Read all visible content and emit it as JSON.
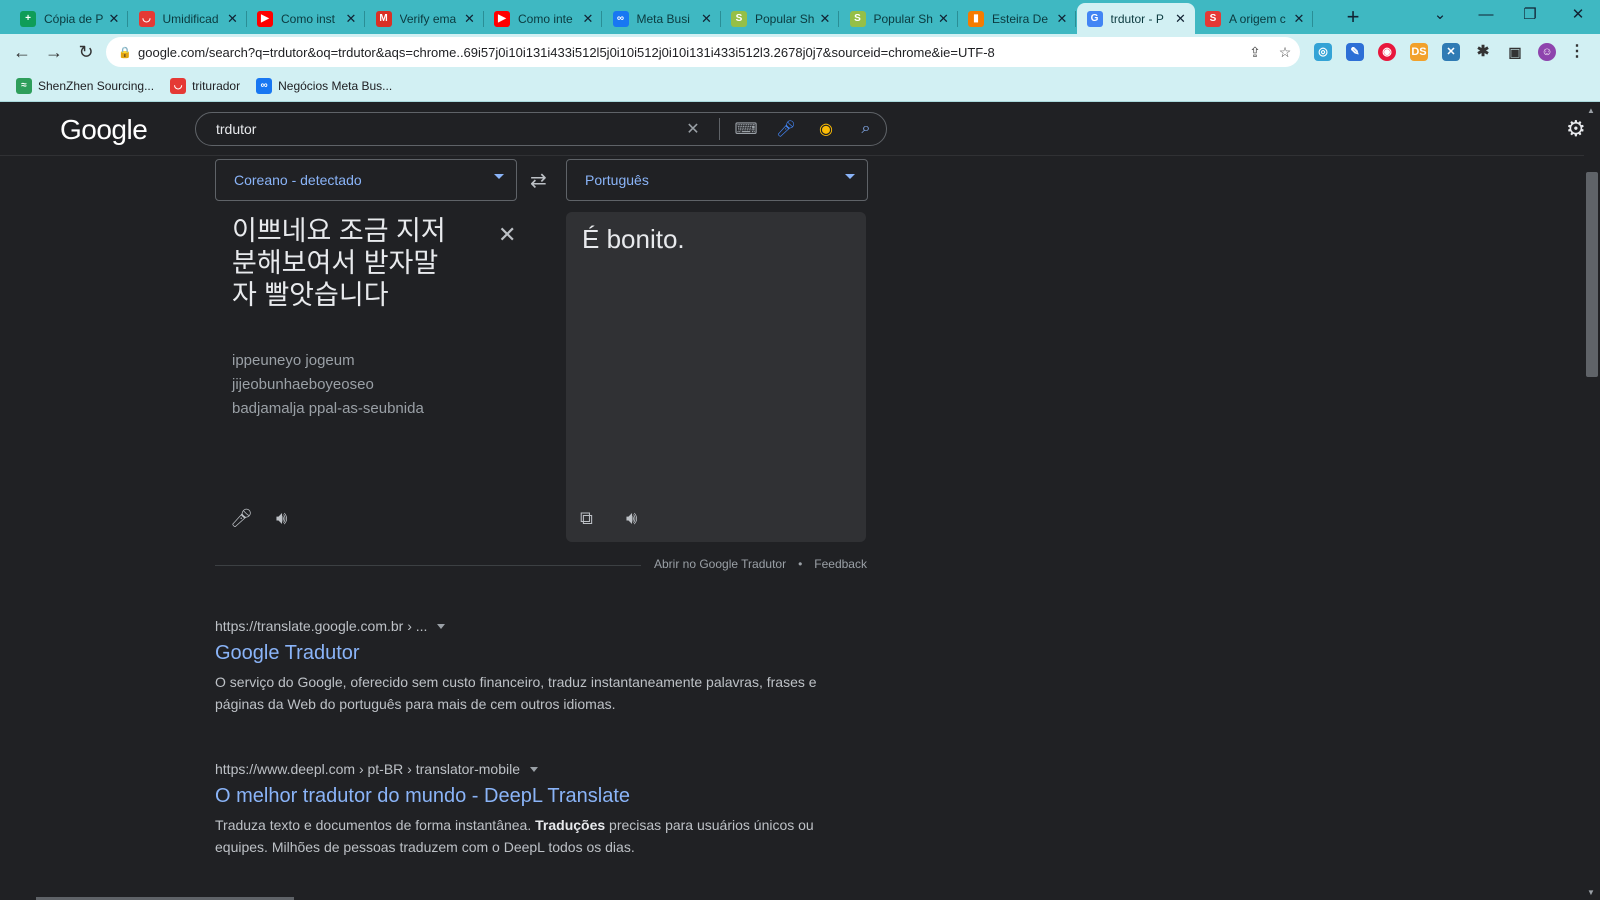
{
  "browser": {
    "tabs": [
      {
        "title": "Cópia de P",
        "icon": "sheets-icon",
        "color": "#0f9d58",
        "glyph": "+"
      },
      {
        "title": "Umidificad",
        "icon": "shopping-bag-icon",
        "color": "#e53935",
        "glyph": "◡"
      },
      {
        "title": "Como inst",
        "icon": "youtube-icon",
        "color": "#ff0000",
        "glyph": "▶"
      },
      {
        "title": "Verify ema",
        "icon": "gmail-icon",
        "color": "#d93025",
        "glyph": "M"
      },
      {
        "title": "Como inte",
        "icon": "youtube-icon",
        "color": "#ff0000",
        "glyph": "▶"
      },
      {
        "title": "Meta Busi",
        "icon": "meta-icon",
        "color": "#1877f2",
        "glyph": "∞"
      },
      {
        "title": "Popular Sh",
        "icon": "shopify-icon",
        "color": "#95bf47",
        "glyph": "S"
      },
      {
        "title": "Popular Sh",
        "icon": "shopify-icon",
        "color": "#95bf47",
        "glyph": "S"
      },
      {
        "title": "Esteira De",
        "icon": "mercado-icon",
        "color": "#f57c00",
        "glyph": "▮"
      },
      {
        "title": "trdutor - P",
        "icon": "google-icon",
        "color": "#4285f4",
        "glyph": "G"
      },
      {
        "title": "A origem c",
        "icon": "s-logo-icon",
        "color": "#e53935",
        "glyph": "S"
      }
    ],
    "url": "google.com/search?q=trdutor&oq=trdutor&aqs=chrome..69i57j0i10i131i433i512l5j0i10i512j0i10i131i433i512l3.2678j0j7&sourceid=chrome&ie=UTF-8",
    "bookmarks": [
      {
        "label": "ShenZhen Sourcing...",
        "icon": "shenzhen-icon",
        "color": "#2e9e5b",
        "glyph": "≈"
      },
      {
        "label": "triturador",
        "icon": "shopping-bag-icon",
        "color": "#e53935",
        "glyph": "◡"
      },
      {
        "label": "Negócios Meta Bus...",
        "icon": "meta-icon",
        "color": "#1877f2",
        "glyph": "∞"
      }
    ]
  },
  "google": {
    "logo": "Google",
    "query": "trdutor"
  },
  "translate": {
    "source_lang": "Coreano - detectado",
    "target_lang": "Português",
    "source_text": "이쁘네요 조금 지저분해보여서 받자말자 빨앗습니다",
    "romanization": [
      "ippeuneyo jogeum",
      "jijeobunhaeboyeoseo",
      "badjamalja ppal-as-seubnida"
    ],
    "translation": "É bonito.",
    "open_link": "Abrir no Google Tradutor",
    "separator": "•",
    "feedback": "Feedback"
  },
  "results": [
    {
      "cite": "https://translate.google.com.br › ...",
      "title": "Google Tradutor",
      "snippet": "O serviço do Google, oferecido sem custo financeiro, traduz instantaneamente palavras, frases e páginas da Web do português para mais de cem outros idiomas."
    },
    {
      "cite": "https://www.deepl.com › pt-BR › translator-mobile",
      "title": "O melhor tradutor do mundo - DeepL Translate",
      "snippet_pre": "Traduza texto e documentos de forma instantânea. ",
      "snippet_bold": "Traduções",
      "snippet_post": " precisas para usuários únicos ou equipes. Milhões de pessoas traduzem com o DeepL todos os dias."
    }
  ],
  "colors": {
    "link": "#8ab4f8",
    "background": "#202124",
    "panel": "#303134",
    "tabstrip": "#3fb8c2",
    "toolbar": "#d2f0f3"
  }
}
